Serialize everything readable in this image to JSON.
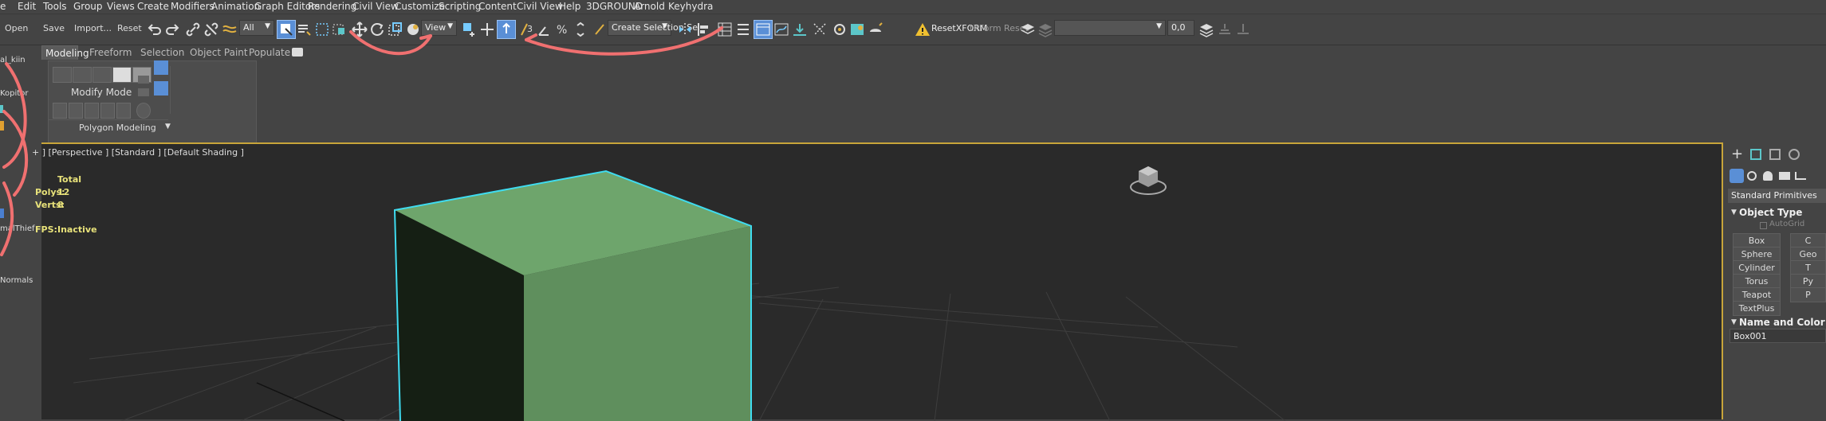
{
  "menubar": {
    "items": [
      "Edit",
      "Tools",
      "Group",
      "Views",
      "Create",
      "Modifiers",
      "Animation",
      "Graph Editors",
      "Rendering",
      "Civil View",
      "Customize",
      "Scripting",
      "Content",
      "Civil View",
      "Help",
      "3DGROUND",
      "Arnold",
      "Keyhydra"
    ],
    "first_fragment": "e"
  },
  "toolbar": {
    "open": "Open",
    "save": "Save",
    "import": "Import...",
    "reset": "Reset",
    "filter_value": "All",
    "view_value": "View",
    "selection_set": "Create Selection Se",
    "warning_icon": "warning-icon",
    "resetxform": "ResetXFORM",
    "xform_reset": "tXForm Reset",
    "spinner_value": "0,0"
  },
  "ribbon": {
    "tabs": [
      "Modeling",
      "Freeform",
      "Selection",
      "Object Paint",
      "Populate"
    ],
    "modify_mode": "Modify Mode",
    "polygon_modeling": "Polygon Modeling"
  },
  "left_strip": {
    "label1": "al_kiin",
    "label2": "Kopitor",
    "label3": "malThief",
    "label4": "Normals"
  },
  "viewport": {
    "label": "+ ] [Perspective ] [Standard ] [Default Shading ]",
    "stats": {
      "total": "Total",
      "polys_label": "Polys:",
      "polys_value": "12",
      "verts_label": "Verts:",
      "verts_value": "8",
      "fps_label": "FPS:",
      "fps_value": "Inactive"
    },
    "box_color": "#6ea56c",
    "edge_color": "#3fdcf0"
  },
  "command_panel": {
    "category": "Standard Primitives",
    "object_type": "Object Type",
    "autogrid": "AutoGrid",
    "buttons": [
      "Box",
      "Sphere",
      "Cylinder",
      "Torus",
      "Teapot",
      "TextPlus"
    ],
    "buttons_right": [
      "C",
      "Geo",
      "T",
      "Py",
      "P"
    ],
    "name_and_color": "Name and Color",
    "object_name": "Box001"
  }
}
